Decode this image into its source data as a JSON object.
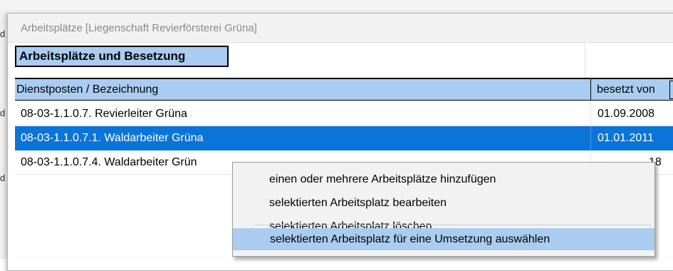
{
  "dialog": {
    "title": "Arbeitsplätze [Liegenschaft Revierförsterei Grüna]",
    "section_header": "Arbeitsplätze und Besetzung"
  },
  "table": {
    "columns": [
      "Dienstposten / Bezeichnung",
      "besetzt von"
    ],
    "rows": [
      {
        "name": "08-03-1.1.0.7. Revierleiter Grüna",
        "date": "01.09.2008"
      },
      {
        "name": "08-03-1.1.0.7.1. Waldarbeiter Grüna",
        "date": "01.01.2011",
        "selected": true
      },
      {
        "name": "08-03-1.1.0.7.4. Waldarbeiter Grün",
        "date": "18"
      }
    ]
  },
  "context_menu": {
    "items": [
      "einen oder mehrere Arbeitsplätze hinzufügen",
      "selektierten Arbeitsplatz bearbeiten",
      "selektierten Arbeitsplatz löschen",
      "selektierten Arbeitsplatz für eine Umsetzung auswählen"
    ],
    "highlighted_index": 3
  },
  "background": {
    "left_marks": [
      "d",
      "d",
      "d"
    ]
  },
  "colors": {
    "header_blue": "#a9ccf0",
    "selection_blue": "#0a74d8",
    "menu_bg": "#f2f2f2"
  }
}
